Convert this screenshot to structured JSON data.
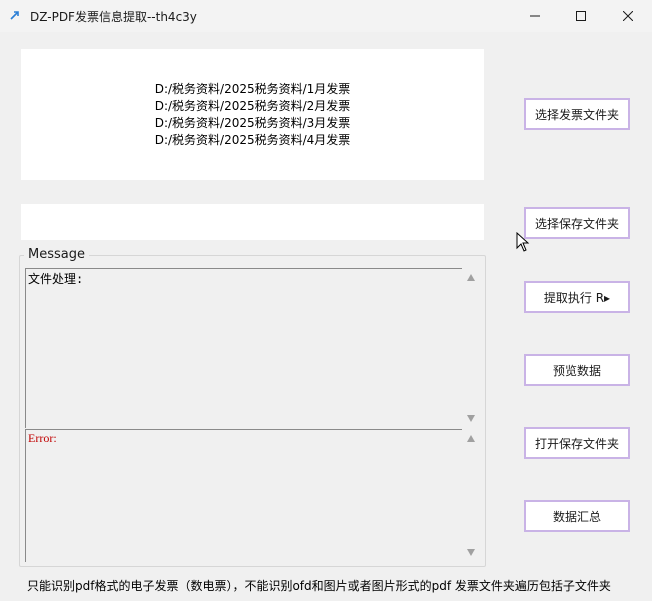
{
  "window": {
    "title": "DZ-PDF发票信息提取--th4c3y",
    "icon": "app-icon"
  },
  "invoice_folders": [
    "D:/税务资料/2025税务资料/1月发票",
    "D:/税务资料/2025税务资料/2月发票",
    "D:/税务资料/2025税务资料/3月发票",
    "D:/税务资料/2025税务资料/4月发票"
  ],
  "save_folder": "",
  "message": {
    "label": "Message",
    "process_text": "文件处理:",
    "error_text": "Error:"
  },
  "buttons": {
    "select_invoice_folder": "选择发票文件夹",
    "select_save_folder": "选择保存文件夹",
    "extract_execute": "提取执行 R▸",
    "preview_data": "预览数据",
    "open_save_folder": "打开保存文件夹",
    "data_summary": "数据汇总"
  },
  "footer_note": "只能识别pdf格式的电子发票（数电票），不能识别ofd和图片或者图片形式的pdf   发票文件夹遍历包括子文件夹",
  "colors": {
    "button_border": "#c9b3e6",
    "error_text": "#c00000"
  }
}
